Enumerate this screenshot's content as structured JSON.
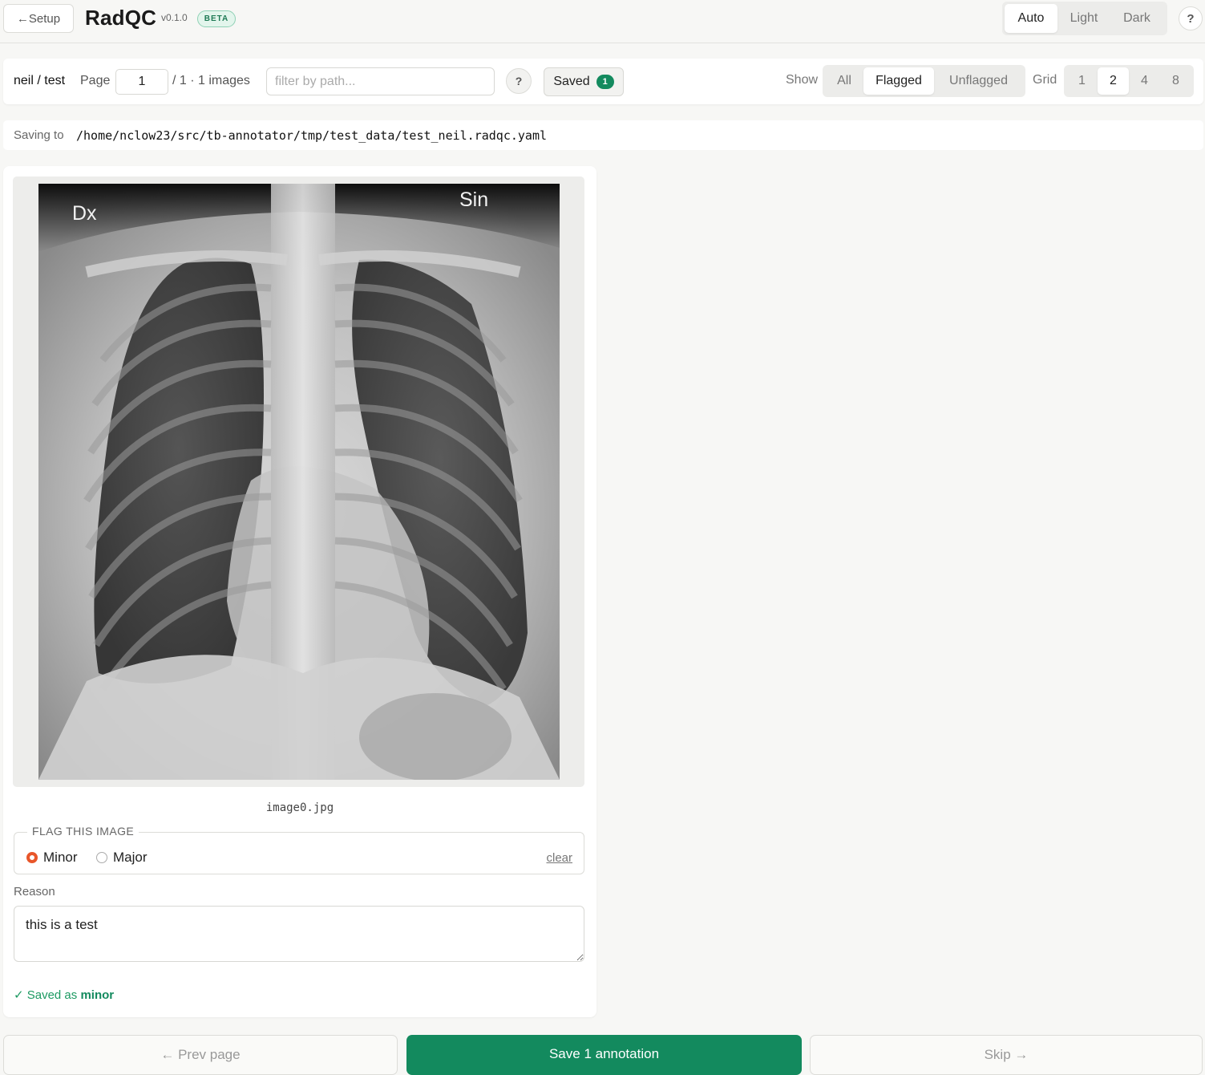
{
  "topbar": {
    "setup_label": "←Setup",
    "app_title": "RadQC",
    "version": "v0.1.0",
    "beta": "BETA",
    "theme_options": [
      "Auto",
      "Light",
      "Dark"
    ],
    "theme_selected": "Auto",
    "help": "?"
  },
  "toolbar": {
    "dataset": "neil / test",
    "page_label": "Page",
    "page_value": "1",
    "page_total": "/ 1 · 1 images",
    "filter_placeholder": "filter by path...",
    "filter_help": "?",
    "saved_label": "Saved",
    "saved_count": "1",
    "show_label": "Show",
    "show_options": [
      "All",
      "Flagged",
      "Unflagged"
    ],
    "show_selected": "Flagged",
    "grid_label": "Grid",
    "grid_options": [
      "1",
      "2",
      "4",
      "8"
    ],
    "grid_selected": "2"
  },
  "savepath": {
    "label": "Saving to",
    "value": "/home/nclow23/src/tb-annotator/tmp/test_data/test_neil.radqc.yaml"
  },
  "card": {
    "image": {
      "left_marker": "Dx",
      "right_marker": "Sin"
    },
    "filename": "image0.jpg",
    "flag": {
      "legend": "FLAG THIS IMAGE",
      "options": [
        "Minor",
        "Major"
      ],
      "selected": "Minor",
      "clear": "clear"
    },
    "reason_label": "Reason",
    "reason_value": "this is a test",
    "status_prefix": "✓ Saved as",
    "status_value": "minor"
  },
  "bottom": {
    "prev": "← Prev page",
    "save": "Save 1 annotation",
    "skip": "Skip →"
  },
  "colors": {
    "accent_green": "#138a5e",
    "radio_orange": "#e8562a"
  }
}
